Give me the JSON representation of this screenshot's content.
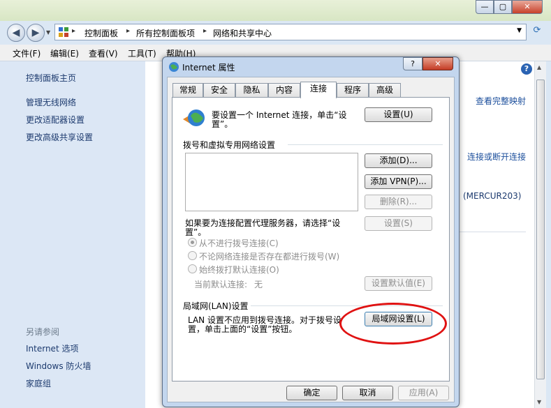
{
  "explorer": {
    "window_buttons": {
      "min": "—",
      "max": "▢",
      "close": "✕"
    },
    "breadcrumb": [
      "控制面板",
      "所有控制面板项",
      "网络和共享中心"
    ],
    "menu": [
      "文件(F)",
      "编辑(E)",
      "查看(V)",
      "工具(T)",
      "帮助(H)"
    ],
    "sidebar": {
      "links": [
        "控制面板主页",
        "管理无线网络",
        "更改适配器设置",
        "更改高级共享设置"
      ],
      "see_also_title": "另请参阅",
      "see_also": [
        "Internet 选项",
        "Windows 防火墙",
        "家庭组"
      ]
    },
    "content": {
      "link_full_map": "查看完整映射",
      "link_connect": "连接或断开连接",
      "mercur_text": "(MERCUR203)"
    }
  },
  "dialog": {
    "title": "Internet 属性",
    "help_btn": "?",
    "close_btn": "✕",
    "tabs": [
      "常规",
      "安全",
      "隐私",
      "内容",
      "连接",
      "程序",
      "高级"
    ],
    "active_tab": "连接",
    "setup": {
      "text_line1": "要设置一个 Internet 连接，单击“设",
      "text_line2": "置”。",
      "button": "设置(U)"
    },
    "dialup": {
      "group_title": "拨号和虚拟专用网络设置",
      "add": "添加(D)...",
      "add_vpn": "添加 VPN(P)...",
      "delete": "删除(R)...",
      "proxy_text_line1": "如果要为连接配置代理服务器，请选择“设",
      "proxy_text_line2": "置”。",
      "settings": "设置(S)",
      "radios": [
        "从不进行拨号连接(C)",
        "不论网络连接是否存在都进行拨号(W)",
        "始终拨打默认连接(O)"
      ],
      "current_default_label": "当前默认连接:",
      "current_default_value": "无",
      "set_default": "设置默认值(E)"
    },
    "lan": {
      "group_title": "局域网(LAN)设置",
      "text_line1": "LAN 设置不应用到拨号连接。对于拨号设",
      "text_line2": "置，单击上面的“设置”按钮。",
      "button": "局域网设置(L)"
    },
    "footer": {
      "ok": "确定",
      "cancel": "取消",
      "apply": "应用(A)"
    }
  },
  "colors": {
    "annotation_ring": "#e01212",
    "link": "#1c3a6e",
    "disabled_text": "#8d8d8d"
  }
}
